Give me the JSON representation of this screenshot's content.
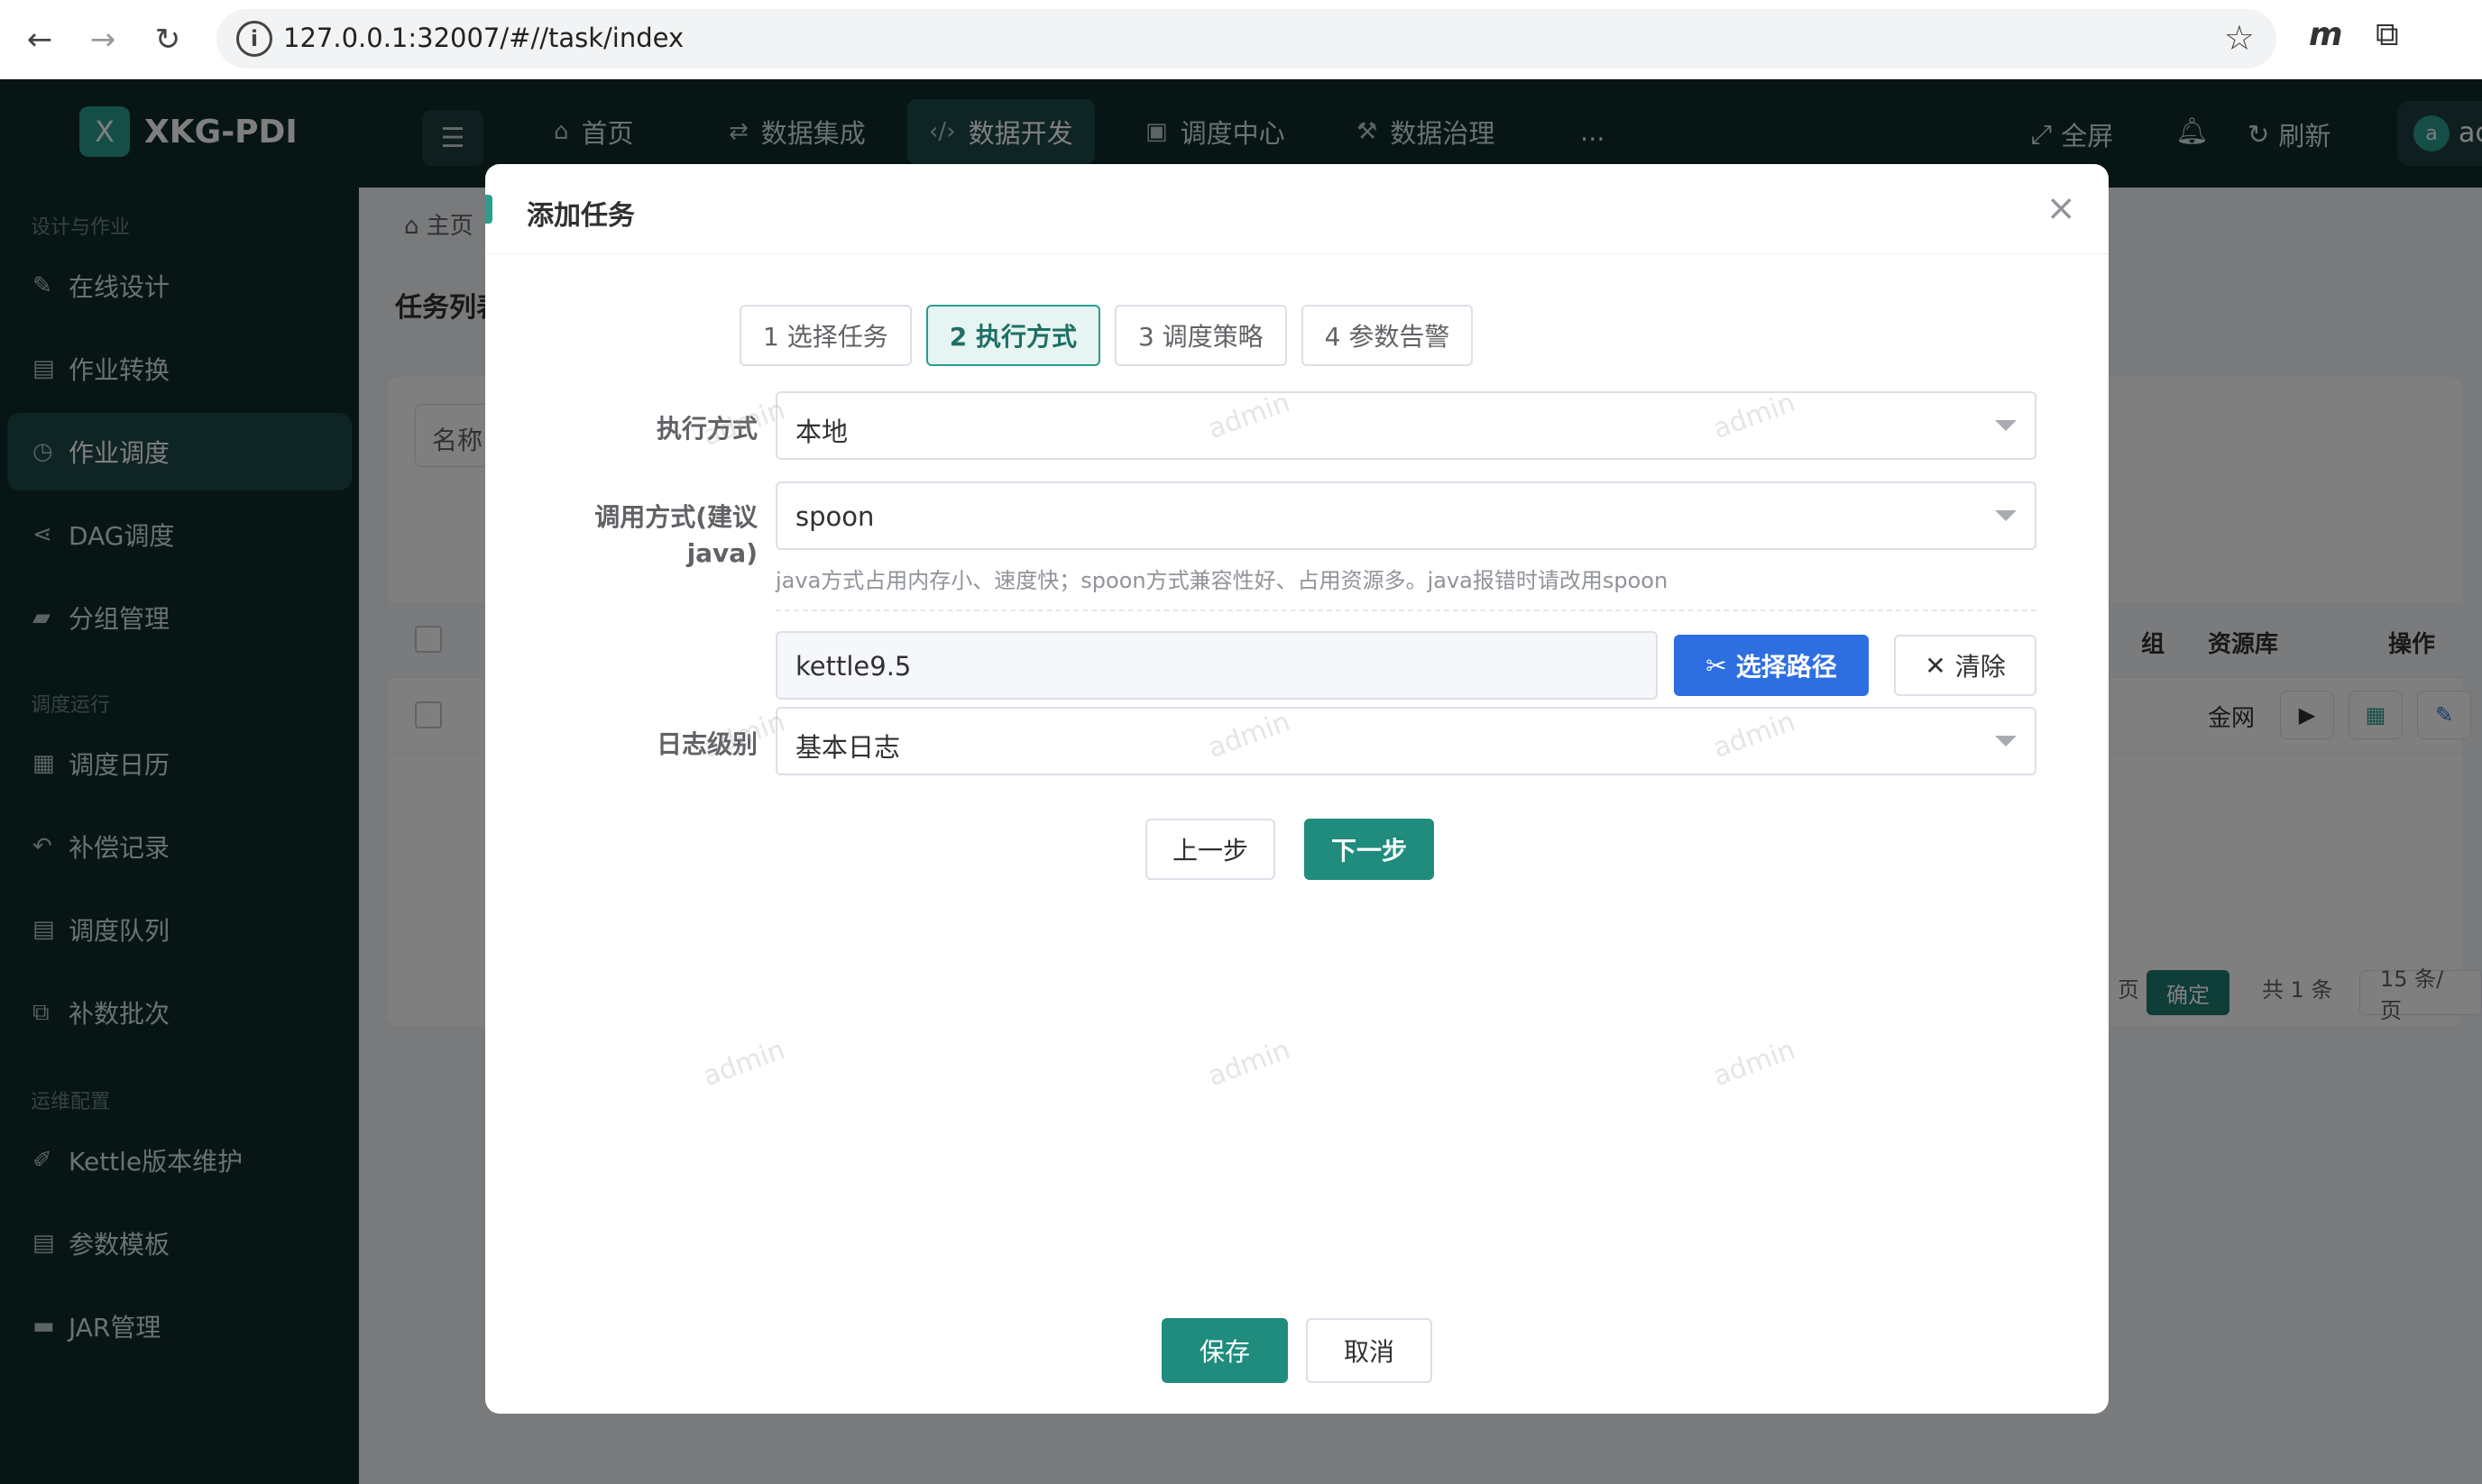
{
  "browser": {
    "url": "127.0.0.1:32007/#//task/index",
    "back_icon": "arrow-left-icon",
    "forward_icon": "arrow-right-icon",
    "reload_icon": "reload-icon",
    "ext_m": "m"
  },
  "app": {
    "logo_mark": "X",
    "name": "XKG-PDI",
    "accent_color": "#2a9d8f"
  },
  "sidebar": {
    "groups": [
      {
        "title": "设计与作业",
        "items": [
          "在线设计",
          "作业转换",
          "作业调度",
          "DAG调度",
          "分组管理"
        ]
      },
      {
        "title": "调度运行",
        "items": [
          "调度日历",
          "补偿记录",
          "调度队列",
          "补数批次"
        ]
      },
      {
        "title": "运维配置",
        "items": [
          "Kettle版本维护",
          "参数模板",
          "JAR管理"
        ]
      }
    ],
    "active": "作业调度"
  },
  "topnav": {
    "items": [
      "首页",
      "数据集成",
      "数据开发",
      "调度中心",
      "数据治理"
    ],
    "more": "...",
    "active": "数据开发",
    "fullscreen": "全屏",
    "refresh": "刷新",
    "avatar_letter": "a",
    "user_name": "ac"
  },
  "background": {
    "breadcrumb": "主页",
    "page_title": "任务列表",
    "filter_label": "名称",
    "add_label": "+",
    "table_headers": {
      "group": "组",
      "resource": "资源库",
      "ops": "操作"
    },
    "row_resource": "金网",
    "pager": {
      "page_suffix": "页",
      "confirm": "确定",
      "total": "共 1 条",
      "size": "15 条/页"
    }
  },
  "modal": {
    "title": "添加任务",
    "close": "×",
    "steps": [
      "1 选择任务",
      "2 执行方式",
      "3 调度策略",
      "4 参数告警"
    ],
    "active_step": 1,
    "fields": {
      "exec_mode_label": "执行方式",
      "exec_mode_value": "本地",
      "invoke_label_line1": "调用方式(建议",
      "invoke_label_line2": "java)",
      "invoke_value": "spoon",
      "invoke_hint": "java方式占用内存小、速度快；spoon方式兼容性好、占用资源多。java报错时请改用spoon",
      "kettle_path": "kettle9.5",
      "choose_path_label": "选择路径",
      "clear_label": "清除",
      "log_level_label": "日志级别",
      "log_level_value": "基本日志"
    },
    "prev_label": "上一步",
    "next_label": "下一步",
    "save_label": "保存",
    "cancel_label": "取消"
  },
  "watermark_text": "admin"
}
